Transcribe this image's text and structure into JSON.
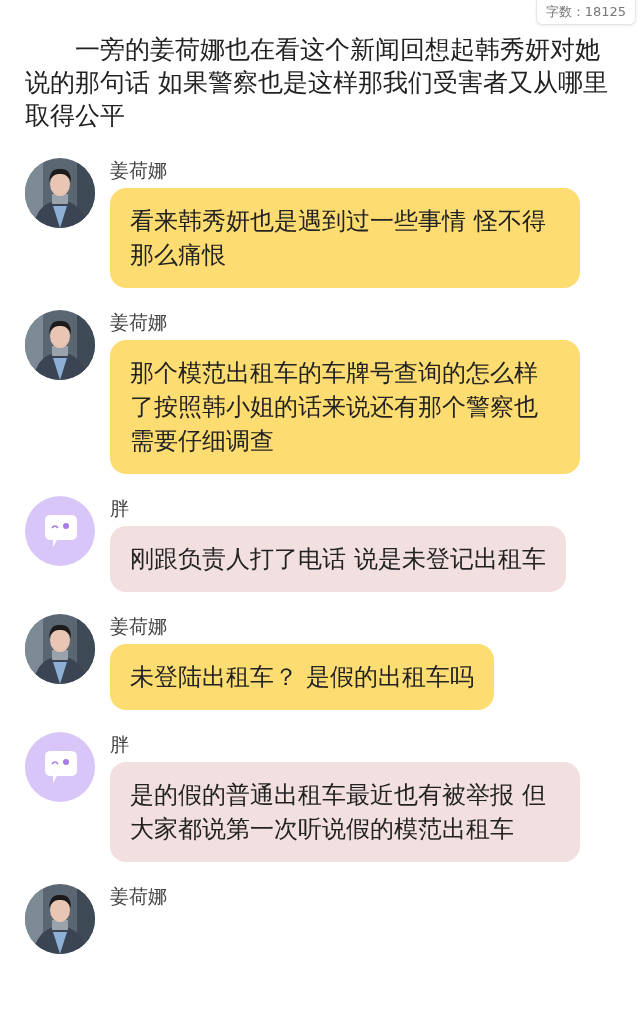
{
  "word_count": "字数：18125",
  "paragraph": "一旁的姜荷娜也在看这个新闻回想起韩秀妍对她说的那句话 如果警察也是这样那我们受害者又从哪里取得公平",
  "messages": [
    {
      "kind": "person",
      "name": "姜荷娜",
      "text": "看来韩秀妍也是遇到过一些事情 怪不得那么痛恨"
    },
    {
      "kind": "person",
      "name": "姜荷娜",
      "text": "那个模范出租车的车牌号查询的怎么样了按照韩小姐的话来说还有那个警察也需要仔细调查"
    },
    {
      "kind": "bot",
      "name": "胖",
      "text": "刚跟负责人打了电话 说是未登记出租车"
    },
    {
      "kind": "person",
      "name": "姜荷娜",
      "text": "未登陆出租车？ 是假的出租车吗"
    },
    {
      "kind": "bot",
      "name": "胖",
      "text": "是的假的普通出租车最近也有被举报 但大家都说第一次听说假的模范出租车"
    },
    {
      "kind": "person",
      "name": "姜荷娜"
    }
  ]
}
